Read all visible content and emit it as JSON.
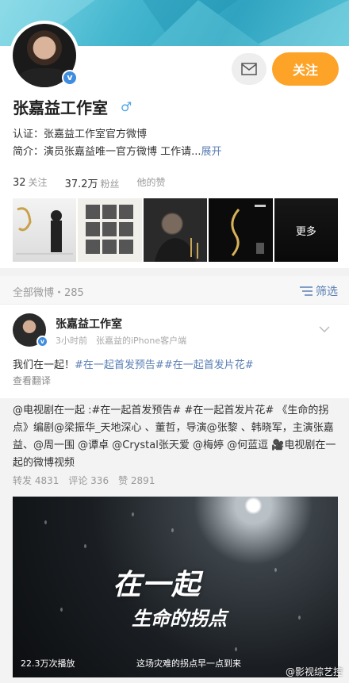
{
  "profile": {
    "name": "张嘉益工作室",
    "gender_icon": "♂",
    "verification": "认证：张嘉益工作室官方微博",
    "intro_prefix": "简介：演员张嘉益唯一官方微博 工作请...",
    "intro_expand": "展开",
    "follow_label": "关注",
    "follow_color": "#fda328"
  },
  "counts": {
    "following_num": "32",
    "following_label": "关注",
    "fans_num": "37.2万",
    "fans_label": "粉丝",
    "likes_label": "他的赞"
  },
  "photos": {
    "more_label": "更多"
  },
  "feed_bar": {
    "all_label": "全部微博・285",
    "filter_label": "筛选"
  },
  "post": {
    "author": "张嘉益工作室",
    "meta": "3小时前　张嘉益的iPhone客户端",
    "text_prefix": "我们在一起！",
    "tag1": "#在一起首发预告#",
    "tag2": "#在一起首发片花#",
    "translate": "查看翻译"
  },
  "repost": {
    "text": "@电视剧在一起 :#在一起首发预告# #在一起首发片花# 《生命的拐点》编剧@梁振华_天地深心 、董哲，导演@张黎 、韩晓军，主演张嘉益、@周一围 @谭卓 @Crystal张天爱 @梅婷 @何蓝逗 🎥电视剧在一起的微博视频",
    "reposts": "转发 4831",
    "comments": "评论 336",
    "likes": "赞 2891"
  },
  "video": {
    "title_line1": "在一起",
    "title_line2": "生命的拐点",
    "plays": "22.3万次播放",
    "caption": "这场灾难的拐点早一点到来"
  },
  "watermark": "@影视综艺控"
}
